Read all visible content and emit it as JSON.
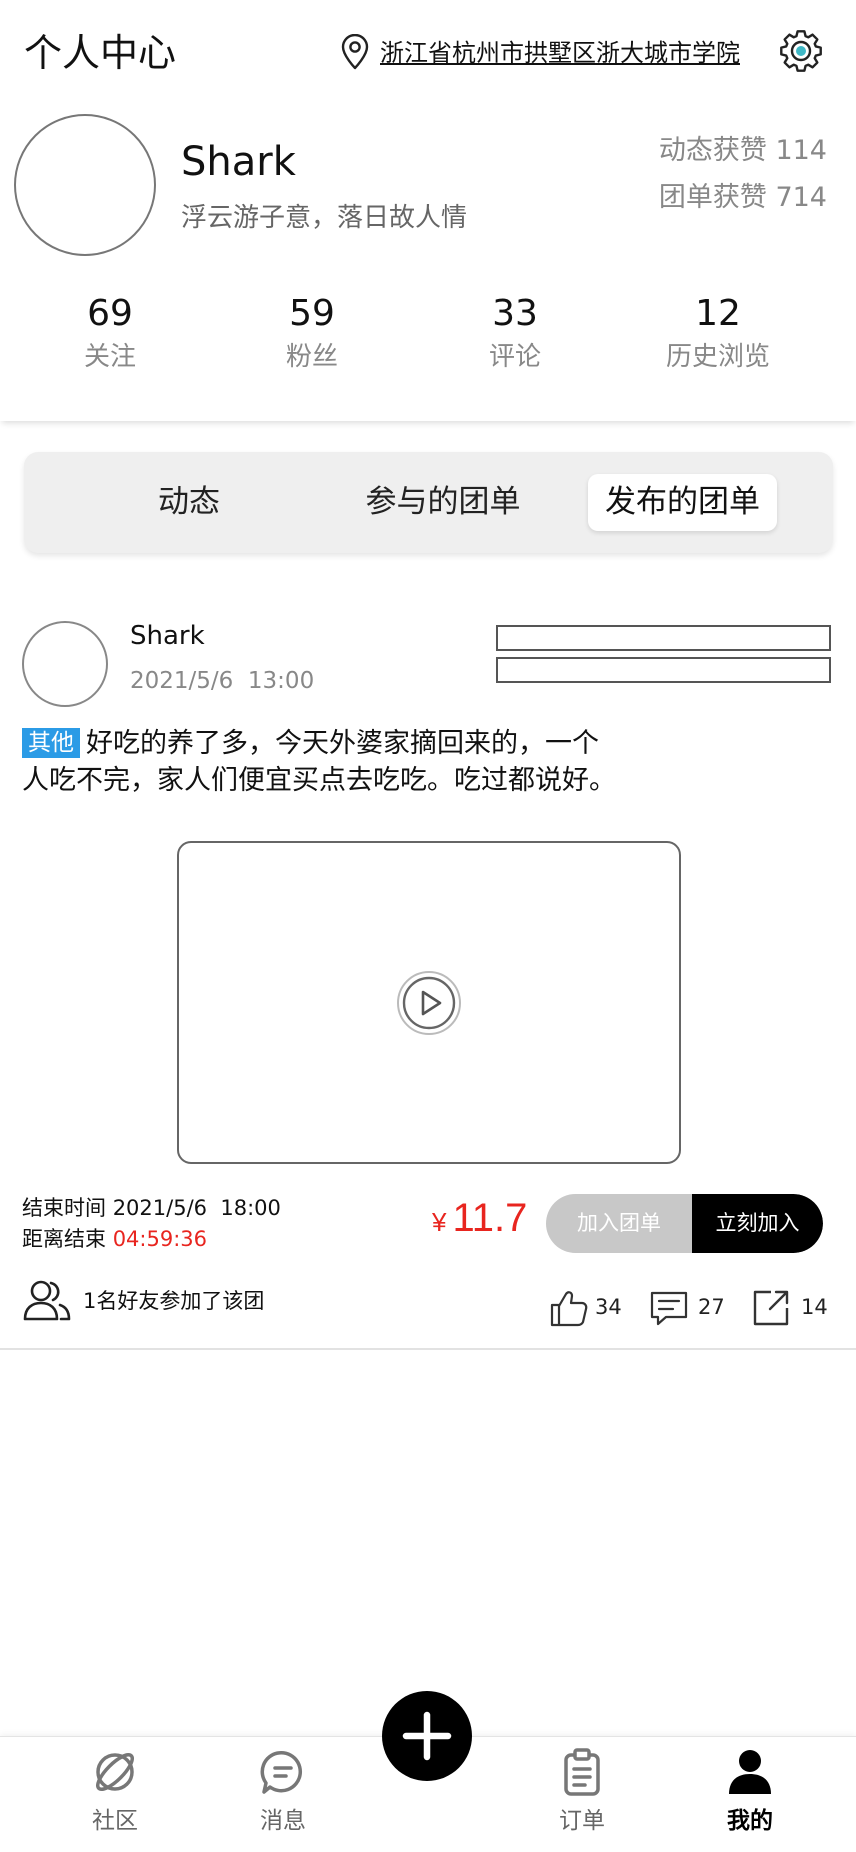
{
  "header": {
    "title": "个人中心",
    "location": "浙江省杭州市拱墅区浙大城市学院",
    "location_icon": "location-pin-icon",
    "settings_icon": "gear-icon"
  },
  "profile": {
    "name": "Shark",
    "bio": "浮云游子意，落日故人情",
    "likes": [
      {
        "label": "动态获赞",
        "value": "114"
      },
      {
        "label": "团单获赞",
        "value": "714"
      }
    ]
  },
  "stats": [
    {
      "value": "69",
      "label": "关注"
    },
    {
      "value": "59",
      "label": "粉丝"
    },
    {
      "value": "33",
      "label": "评论"
    },
    {
      "value": "12",
      "label": "历史浏览"
    }
  ],
  "tabs": [
    {
      "label": "动态",
      "selected": false
    },
    {
      "label": "参与的团单",
      "selected": false
    },
    {
      "label": "发布的团单",
      "selected": true
    }
  ],
  "post": {
    "author": "Shark",
    "time": "2021/5/6  13:00",
    "tag": "其他",
    "content": "好吃的养了多，今天外婆家摘回来的，一个人吃不完，家人们便宜买点去吃吃。吃过都说好。",
    "end_time_label": "结束时间",
    "end_time": "2021/5/6  18:00",
    "countdown_label": "距离结束",
    "countdown": "04:59:36",
    "currency": "¥",
    "price": "11.7",
    "join_group_label": "加入团单",
    "join_now_label": "立刻加入",
    "friends_text": "1名好友参加了该团",
    "likes": "34",
    "comments": "27",
    "shares": "14"
  },
  "nav": [
    {
      "label": "社区",
      "icon": "planet-icon",
      "selected": false
    },
    {
      "label": "消息",
      "icon": "message-icon",
      "selected": false
    },
    {
      "label": "订单",
      "icon": "clipboard-icon",
      "selected": false
    },
    {
      "label": "我的",
      "icon": "person-icon",
      "selected": true
    }
  ],
  "center_action_icon": "plus-icon",
  "colors": {
    "tag": "#2b9be6",
    "price": "#e8251f",
    "primary": "#000000",
    "muted": "#888888",
    "gear_dot": "#3fb8c6"
  }
}
